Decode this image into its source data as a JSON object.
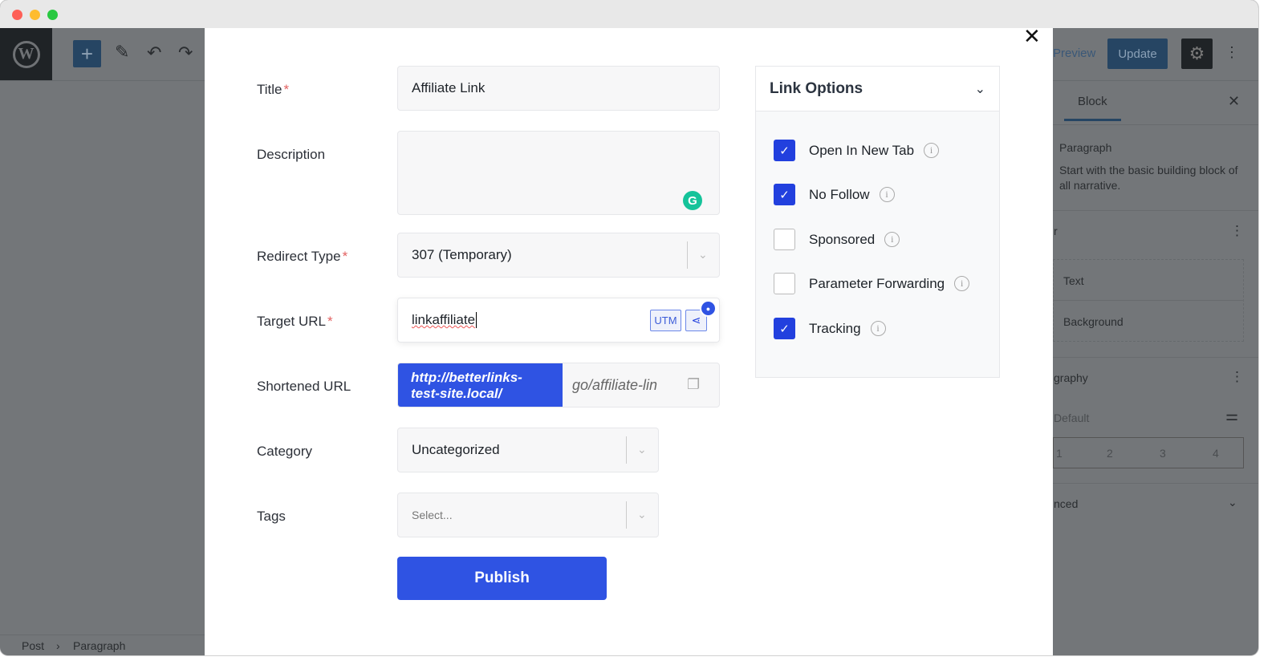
{
  "toolbar": {
    "preview": "Preview",
    "update": "Update"
  },
  "sidebar": {
    "tab": "Block",
    "block_name": "Paragraph",
    "block_desc": "Start with the basic building block of all narrative.",
    "color_title_partial": "r",
    "color_items": [
      "Text",
      "Background"
    ],
    "typography_partial": "graphy",
    "font_size_value": "Default",
    "font_sizes": [
      "1",
      "2",
      "3",
      "4"
    ],
    "advanced_partial": "nced"
  },
  "breadcrumb": [
    "Post",
    "Paragraph"
  ],
  "form": {
    "title_label": "Title",
    "title_value": "Affiliate Link",
    "description_label": "Description",
    "description_value": "",
    "redirect_label": "Redirect Type",
    "redirect_value": "307 (Temporary)",
    "target_label": "Target URL",
    "target_value": "linkaffiliate",
    "utm_label": "UTM",
    "lock_badge": "🔒",
    "short_label": "Shortened URL",
    "short_prefix": "http://betterlinks-test-site.local/",
    "short_slug": "go/affiliate-lin",
    "category_label": "Category",
    "category_value": "Uncategorized",
    "tags_label": "Tags",
    "tags_placeholder": "Select...",
    "publish_label": "Publish",
    "required_mark": "*"
  },
  "link_options": {
    "title": "Link Options",
    "items": [
      {
        "label": "Open In New Tab",
        "checked": true
      },
      {
        "label": "No Follow",
        "checked": true
      },
      {
        "label": "Sponsored",
        "checked": false
      },
      {
        "label": "Parameter Forwarding",
        "checked": false
      },
      {
        "label": "Tracking",
        "checked": true
      }
    ]
  },
  "colors": {
    "accent": "#2f53e3",
    "checkbox": "#2240de",
    "overlay": "#737679"
  }
}
